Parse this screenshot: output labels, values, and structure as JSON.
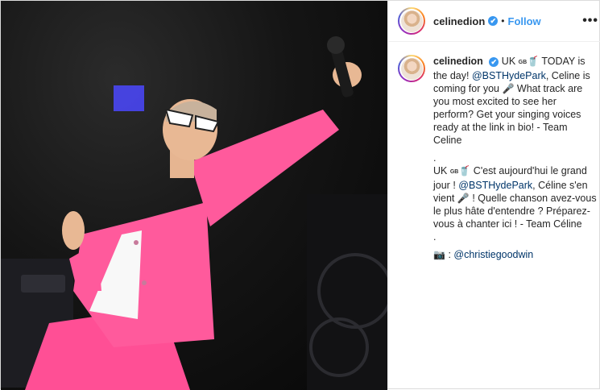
{
  "header": {
    "username": "celinedion",
    "verified_badge": "✔",
    "separator": "•",
    "follow_label": "Follow",
    "more_label": "•••"
  },
  "caption": {
    "username": "celinedion",
    "en_country": "UK",
    "en_flag": "GB",
    "en_emoji": "🥤",
    "en_text_1": "TODAY is the day!",
    "en_mention": "@BSTHydePark",
    "en_text_2": ", Celine is coming for you",
    "en_mic": "🎤",
    "en_text_3": "What track are you most excited to see her perform? Get your singing voices ready at the link in bio! - Team Celine",
    "dot_1": ".",
    "fr_country": "UK",
    "fr_flag": "GB",
    "fr_emoji": "🥤",
    "fr_text_1": "C'est aujourd'hui le grand jour !",
    "fr_mention": "@BSTHydePark",
    "fr_text_2": ", Céline s'en vient",
    "fr_mic": "🎤",
    "fr_text_3": "! Quelle chanson avez-vous le plus hâte d'entendre ? Préparez-vous à chanter ici ! - Team Céline",
    "dot_2": ".",
    "camera_icon": "📷",
    "credit_sep": ":",
    "credit_mention": "@christiegoodwin"
  },
  "colors": {
    "accent": "#3897f0",
    "mention": "#003569",
    "suit_pink": "#ff4f95"
  },
  "icons": [
    "verified-icon",
    "more-options-icon",
    "camera-icon",
    "microphone-icon",
    "flag-gb-icon"
  ]
}
